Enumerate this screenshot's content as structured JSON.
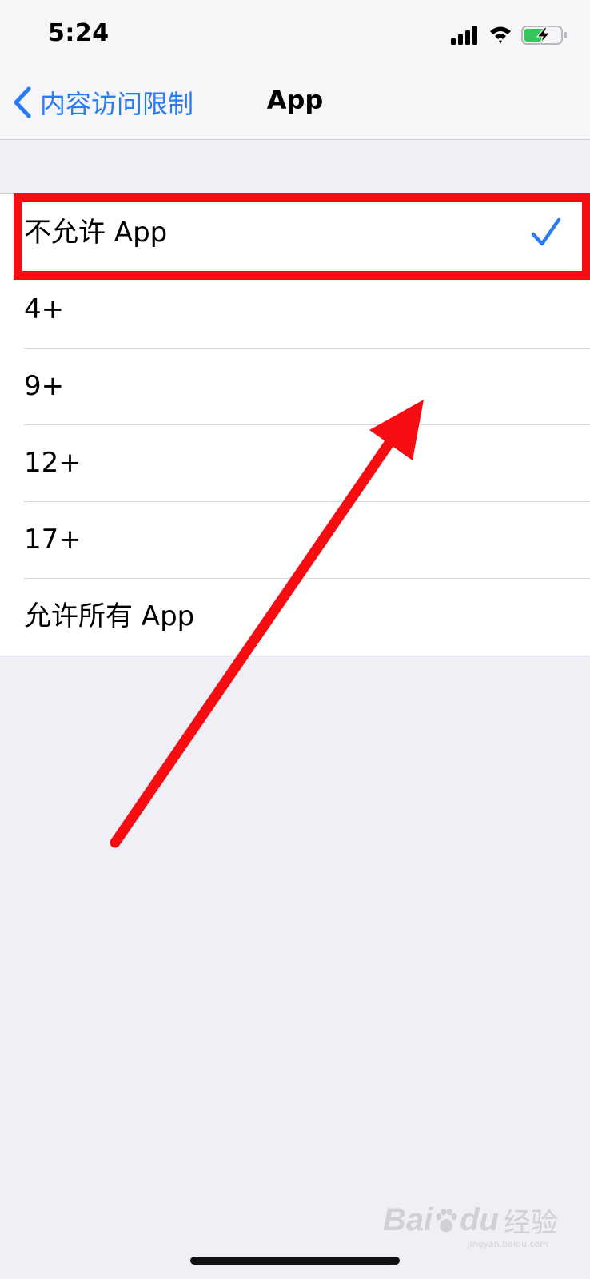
{
  "status_bar": {
    "time": "5:24"
  },
  "nav": {
    "back_label": "内容访问限制",
    "title": "App"
  },
  "options": [
    {
      "label": "不允许 App",
      "selected": true
    },
    {
      "label": "4+",
      "selected": false
    },
    {
      "label": "9+",
      "selected": false
    },
    {
      "label": "12+",
      "selected": false
    },
    {
      "label": "17+",
      "selected": false
    },
    {
      "label": "允许所有 App",
      "selected": false
    }
  ],
  "watermark": {
    "logo_left": "Bai",
    "logo_right": "du",
    "text": "经验",
    "url": "jingyan.baidu.com"
  },
  "colors": {
    "accent": "#2b7cf0",
    "annotation": "#f60d12",
    "background": "#f0eff5"
  },
  "icons": {
    "signal": "cellular-signal-icon",
    "wifi": "wifi-icon",
    "battery": "battery-charging-icon",
    "back": "chevron-left-icon",
    "check": "checkmark-icon"
  }
}
